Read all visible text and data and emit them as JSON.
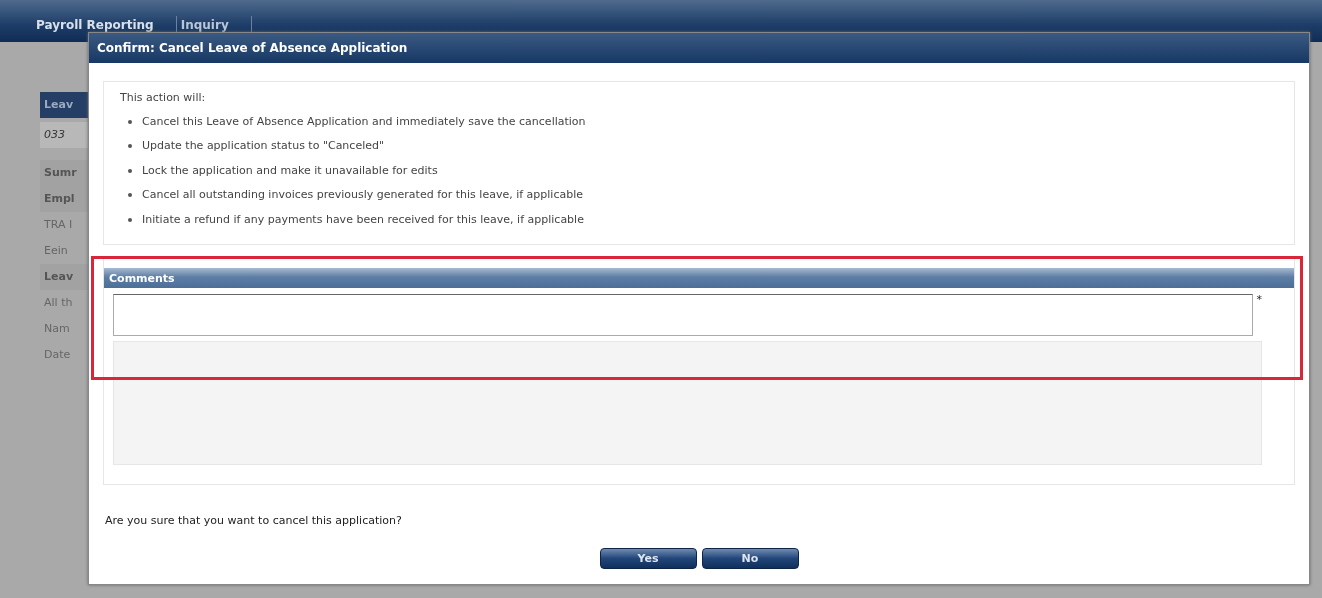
{
  "background_page": {
    "nav_tabs": [
      {
        "label": "Payroll Reporting",
        "selected": true
      },
      {
        "label": "Inquiry",
        "selected": false
      }
    ],
    "left_fragments": [
      {
        "kind": "header",
        "text": "Leav"
      },
      {
        "kind": "box",
        "text": "033"
      },
      {
        "kind": "label",
        "text": "Sumr"
      },
      {
        "kind": "label",
        "text": "Empl"
      },
      {
        "kind": "plain",
        "text": "TRA I"
      },
      {
        "kind": "plain",
        "text": "Eein"
      },
      {
        "kind": "label",
        "text": "Leav"
      },
      {
        "kind": "plain",
        "text": "All th"
      },
      {
        "kind": "plain",
        "text": "Nam"
      },
      {
        "kind": "plain",
        "text": "Date"
      }
    ]
  },
  "dialog": {
    "title": "Confirm: Cancel Leave of Absence Application",
    "intro": "This action will:",
    "bullets": [
      "Cancel this Leave of Absence Application and immediately save the cancellation",
      "Update the application status to \"Canceled\"",
      "Lock the application and make it unavailable for edits",
      "Cancel all outstanding invoices previously generated for this leave, if applicable",
      "Initiate a refund if any payments have been received for this leave, if applicable"
    ],
    "comments": {
      "header": "Comments",
      "required_mark": "*",
      "highlighted": true
    },
    "question": "Are you sure that you want to cancel this application?",
    "buttons": [
      "Yes",
      "No"
    ]
  }
}
